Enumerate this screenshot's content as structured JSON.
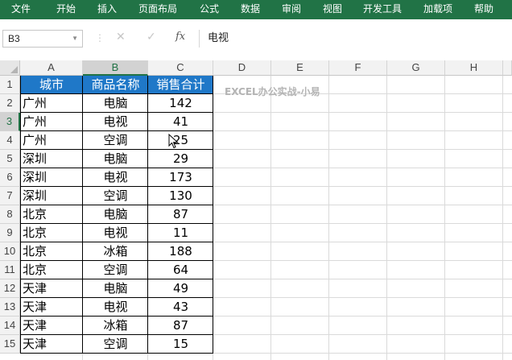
{
  "ribbon": {
    "tabs": [
      "文件",
      "开始",
      "插入",
      "页面布局",
      "公式",
      "数据",
      "审阅",
      "视图",
      "开发工具",
      "加载项",
      "帮助"
    ]
  },
  "formula_bar": {
    "name_box": "B3",
    "fx_label": "fx",
    "value": "电视"
  },
  "columns": [
    "A",
    "B",
    "C",
    "D",
    "E",
    "F",
    "G",
    "H"
  ],
  "rows": [
    "1",
    "2",
    "3",
    "4",
    "5",
    "6",
    "7",
    "8",
    "9",
    "10",
    "11",
    "12",
    "13",
    "14",
    "15"
  ],
  "selected_cell": {
    "column": "B",
    "row": "3"
  },
  "table": {
    "headers": [
      "城市",
      "商品名称",
      "销售合计"
    ],
    "rows": [
      [
        "广州",
        "电脑",
        "142"
      ],
      [
        "广州",
        "电视",
        "41"
      ],
      [
        "广州",
        "空调",
        "25"
      ],
      [
        "深圳",
        "电脑",
        "29"
      ],
      [
        "深圳",
        "电视",
        "173"
      ],
      [
        "深圳",
        "空调",
        "130"
      ],
      [
        "北京",
        "电脑",
        "87"
      ],
      [
        "北京",
        "电视",
        "11"
      ],
      [
        "北京",
        "冰箱",
        "188"
      ],
      [
        "北京",
        "空调",
        "64"
      ],
      [
        "天津",
        "电脑",
        "49"
      ],
      [
        "天津",
        "电视",
        "43"
      ],
      [
        "天津",
        "冰箱",
        "87"
      ],
      [
        "天津",
        "空调",
        "15"
      ]
    ]
  },
  "watermark": "EXCEL办公实战-小易",
  "colors": {
    "ribbon": "#217346",
    "header_fill": "#1f78c8",
    "header_text": "#ffffff"
  },
  "icons": {
    "cancel": "close-icon",
    "confirm": "check-icon",
    "insert_function": "fx-icon",
    "cursor": "mouse-pointer-icon"
  }
}
